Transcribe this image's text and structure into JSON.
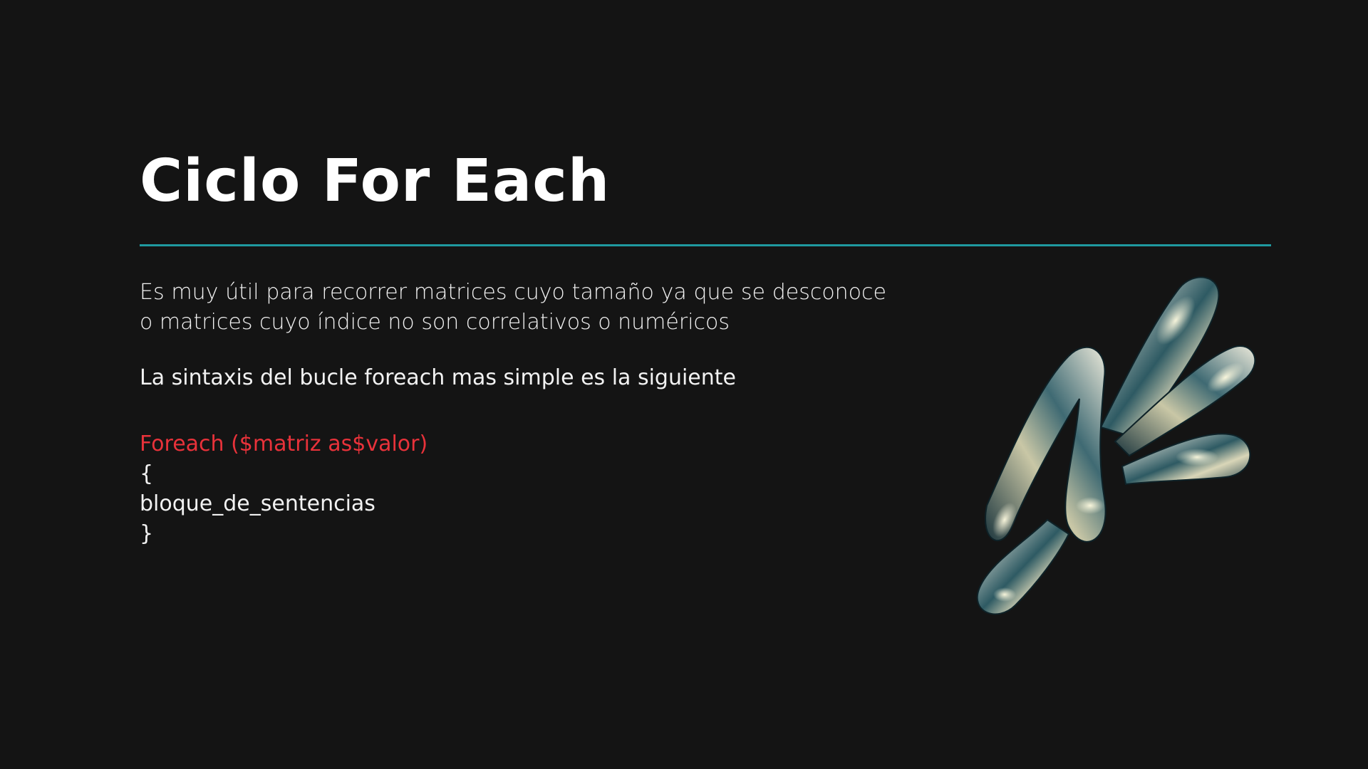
{
  "slide": {
    "title": "Ciclo For Each",
    "paragraph": "Es muy útil para recorrer matrices cuyo tamaño ya que se desconoce o matrices cuyo índice no son correlativos o numéricos",
    "syntax_intro": "La sintaxis del bucle foreach mas simple es la siguiente",
    "code": {
      "line1": "Foreach ($matriz as$valor)",
      "line2": "{",
      "line3": "bloque_de_sentencias",
      "line4": "}"
    }
  },
  "colors": {
    "background": "#141414",
    "divider": "#1f9aa0",
    "keyword": "#e8323a",
    "text": "#ffffff"
  },
  "icons": {
    "decoration": "chrome-blob-illustration"
  }
}
